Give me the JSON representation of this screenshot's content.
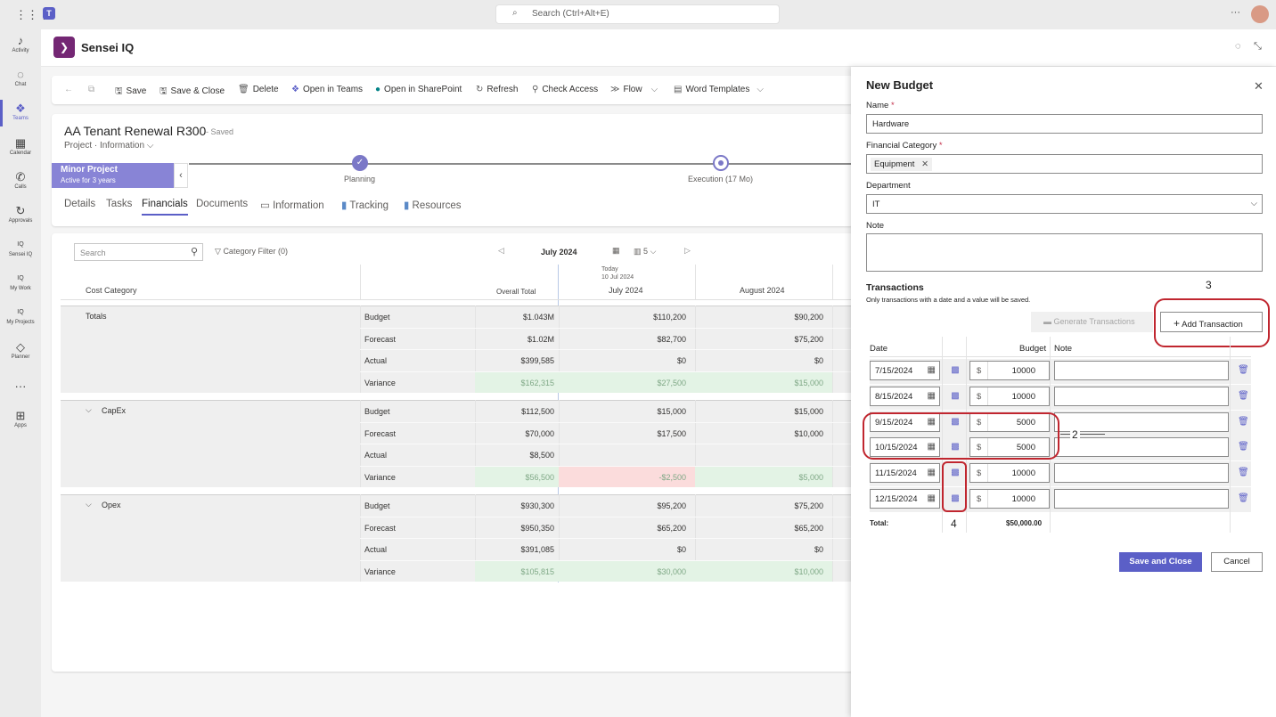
{
  "topbar": {
    "search_placeholder": "Search (Ctrl+Alt+E)",
    "more": "···"
  },
  "rail": [
    {
      "label": "Activity",
      "icon": "♪"
    },
    {
      "label": "Chat",
      "icon": "◌"
    },
    {
      "label": "Teams",
      "icon": "❖"
    },
    {
      "label": "Calendar",
      "icon": "▦"
    },
    {
      "label": "Calls",
      "icon": "✆"
    },
    {
      "label": "Approvals",
      "icon": "↻"
    },
    {
      "label": "Sensei IQ",
      "icon": "IQ"
    },
    {
      "label": "My Work",
      "icon": "IQ"
    },
    {
      "label": "My Projects",
      "icon": "IQ"
    },
    {
      "label": "Planner",
      "icon": "◇"
    },
    {
      "label": "",
      "icon": "···"
    },
    {
      "label": "Apps",
      "icon": "⊞"
    }
  ],
  "app": {
    "name": "Sensei IQ"
  },
  "toolbar": {
    "save": "Save",
    "save_close": "Save & Close",
    "delete": "Delete",
    "open_teams": "Open in Teams",
    "open_sharepoint": "Open in SharePoint",
    "refresh": "Refresh",
    "check_access": "Check Access",
    "flow": "Flow",
    "word_templates": "Word Templates"
  },
  "record": {
    "title": "AA Tenant Renewal R300",
    "status": "- Saved",
    "breadcrumb_type": "Project",
    "breadcrumb_form": "Information"
  },
  "stage": {
    "name": "Minor Project",
    "sub": "Active for 3 years",
    "step1": "Planning",
    "step2": "Execution  (17 Mo)"
  },
  "tabs": [
    "Details",
    "Tasks",
    "Financials",
    "Documents",
    "Information",
    "Tracking",
    "Resources"
  ],
  "grid": {
    "search_placeholder": "Search",
    "category_filter": "Category Filter (0)",
    "month": "July 2024",
    "view_count": "5",
    "today_label": "Today",
    "today_date": "10 Jul 2024",
    "col_cost_category": "Cost Category",
    "col_overall": "Overall Total",
    "col_jul": "July 2024",
    "col_aug": "August 2024",
    "groups": [
      {
        "name": "Totals",
        "rows": [
          {
            "label": "Budget",
            "total": "$1.043M",
            "jul": "$110,200",
            "aug": "$90,200"
          },
          {
            "label": "Forecast",
            "total": "$1.02M",
            "jul": "$82,700",
            "aug": "$75,200"
          },
          {
            "label": "Actual",
            "total": "$399,585",
            "jul": "$0",
            "aug": "$0"
          },
          {
            "label": "Variance",
            "total": "$162,315",
            "jul": "$27,500",
            "aug": "$15,000"
          }
        ]
      },
      {
        "name": "CapEx",
        "rows": [
          {
            "label": "Budget",
            "total": "$112,500",
            "jul": "$15,000",
            "aug": "$15,000"
          },
          {
            "label": "Forecast",
            "total": "$70,000",
            "jul": "$17,500",
            "aug": "$10,000"
          },
          {
            "label": "Actual",
            "total": "$8,500",
            "jul": "",
            "aug": ""
          },
          {
            "label": "Variance",
            "total": "$56,500",
            "jul": "-$2,500",
            "aug": "$5,000"
          }
        ]
      },
      {
        "name": "Opex",
        "rows": [
          {
            "label": "Budget",
            "total": "$930,300",
            "jul": "$95,200",
            "aug": "$75,200"
          },
          {
            "label": "Forecast",
            "total": "$950,350",
            "jul": "$65,200",
            "aug": "$65,200"
          },
          {
            "label": "Actual",
            "total": "$391,085",
            "jul": "$0",
            "aug": "$0"
          },
          {
            "label": "Variance",
            "total": "$105,815",
            "jul": "$30,000",
            "aug": "$10,000"
          }
        ]
      }
    ]
  },
  "panel": {
    "title": "New Budget",
    "name_label": "Name",
    "name_value": "Hardware",
    "fincat_label": "Financial Category",
    "fincat_value": "Equipment",
    "dept_label": "Department",
    "dept_value": "IT",
    "note_label": "Note",
    "trans_title": "Transactions",
    "trans_hint": "Only transactions with a date and a value will be saved.",
    "gen_btn": "Generate Transactions",
    "add_btn": "Add Transaction",
    "col_date": "Date",
    "col_budget": "Budget",
    "col_note": "Note",
    "transactions": [
      {
        "date": "7/15/2024",
        "amount": "10000"
      },
      {
        "date": "8/15/2024",
        "amount": "10000"
      },
      {
        "date": "9/15/2024",
        "amount": "5000"
      },
      {
        "date": "10/15/2024",
        "amount": "5000"
      },
      {
        "date": "11/15/2024",
        "amount": "10000"
      },
      {
        "date": "12/15/2024",
        "amount": "10000"
      }
    ],
    "total_label": "Total:",
    "total_value": "$50,000.00",
    "save_close": "Save and Close",
    "cancel": "Cancel"
  },
  "annotations": {
    "a2": "2",
    "a3": "3",
    "a4": "4"
  },
  "colors": {
    "accent": "#5b5fc7",
    "annotation": "#c0262f",
    "positive": "#e3f3e5",
    "negative": "#fbdcdc"
  }
}
